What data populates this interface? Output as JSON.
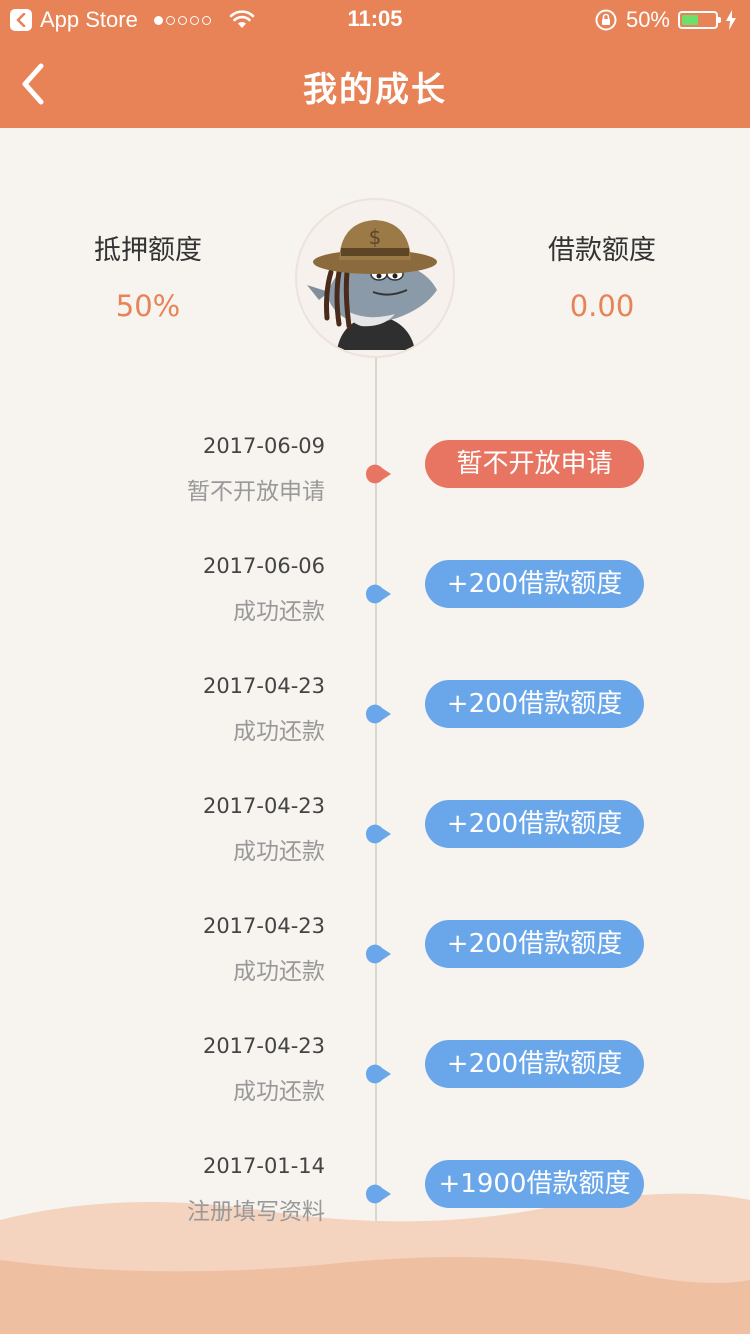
{
  "statusbar": {
    "app": "App Store",
    "time": "11:05",
    "battery": "50%",
    "battery_level": 0.5
  },
  "nav": {
    "title": "我的成长"
  },
  "stats": {
    "left": {
      "label": "抵押额度",
      "value": "50%"
    },
    "right": {
      "label": "借款额度",
      "value": "0.00"
    }
  },
  "colors": {
    "accent": "#e88357",
    "pill_red": "#e87562",
    "pill_blue": "#6aa6ea"
  },
  "timeline": [
    {
      "date": "2017-06-09",
      "desc": "暂不开放申请",
      "badge": "暂不开放申请",
      "style": "red"
    },
    {
      "date": "2017-06-06",
      "desc": "成功还款",
      "badge": "+200借款额度",
      "style": "blue"
    },
    {
      "date": "2017-04-23",
      "desc": "成功还款",
      "badge": "+200借款额度",
      "style": "blue"
    },
    {
      "date": "2017-04-23",
      "desc": "成功还款",
      "badge": "+200借款额度",
      "style": "blue"
    },
    {
      "date": "2017-04-23",
      "desc": "成功还款",
      "badge": "+200借款额度",
      "style": "blue"
    },
    {
      "date": "2017-04-23",
      "desc": "成功还款",
      "badge": "+200借款额度",
      "style": "blue"
    },
    {
      "date": "2017-01-14",
      "desc": "注册填写资料",
      "badge": "+1900借款额度",
      "style": "blue"
    }
  ]
}
